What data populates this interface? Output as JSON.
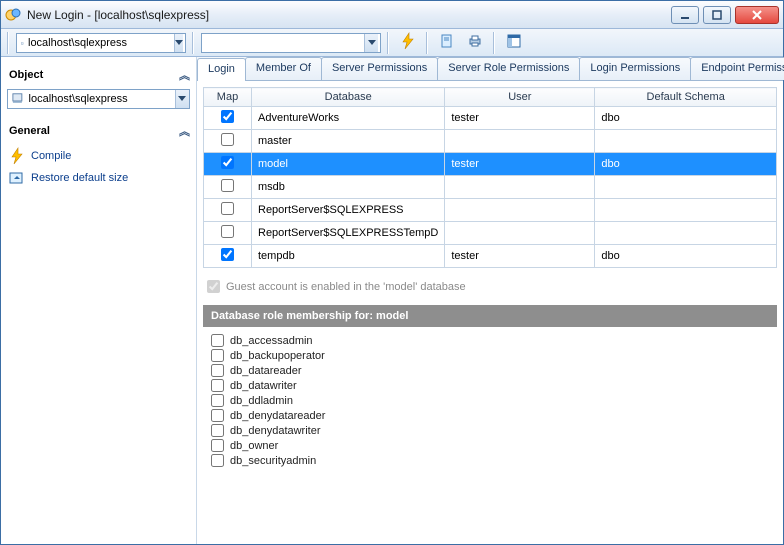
{
  "window": {
    "title": "New Login - [localhost\\sqlexpress]"
  },
  "toolbar": {
    "server_value": "localhost\\sqlexpress",
    "combo2_value": ""
  },
  "left": {
    "object_header": "Object",
    "server_value": "localhost\\sqlexpress",
    "general_header": "General",
    "compile_label": "Compile",
    "restore_label": "Restore default size"
  },
  "tabs": {
    "items": [
      {
        "label": "Login"
      },
      {
        "label": "Member Of"
      },
      {
        "label": "Server Permissions"
      },
      {
        "label": "Server Role Permissions"
      },
      {
        "label": "Login Permissions"
      },
      {
        "label": "Endpoint Permissio"
      }
    ]
  },
  "grid": {
    "cols": {
      "map": "Map",
      "database": "Database",
      "user": "User",
      "schema": "Default Schema"
    },
    "rows": [
      {
        "map": true,
        "db": "AdventureWorks",
        "user": "tester",
        "schema": "dbo",
        "selected": false
      },
      {
        "map": false,
        "db": "master",
        "user": "",
        "schema": "",
        "selected": false
      },
      {
        "map": true,
        "db": "model",
        "user": "tester",
        "schema": "dbo",
        "selected": true
      },
      {
        "map": false,
        "db": "msdb",
        "user": "",
        "schema": "",
        "selected": false
      },
      {
        "map": false,
        "db": "ReportServer$SQLEXPRESS",
        "user": "",
        "schema": "",
        "selected": false
      },
      {
        "map": false,
        "db": "ReportServer$SQLEXPRESSTempD",
        "user": "",
        "schema": "",
        "selected": false
      },
      {
        "map": true,
        "db": "tempdb",
        "user": "tester",
        "schema": "dbo",
        "selected": false
      }
    ]
  },
  "guest": {
    "checked": true,
    "disabled": true,
    "label": "Guest account is enabled in the 'model' database"
  },
  "roles": {
    "header": "Database role membership for: model",
    "items": [
      {
        "label": "db_accessadmin",
        "checked": false
      },
      {
        "label": "db_backupoperator",
        "checked": false
      },
      {
        "label": "db_datareader",
        "checked": false
      },
      {
        "label": "db_datawriter",
        "checked": false
      },
      {
        "label": "db_ddladmin",
        "checked": false
      },
      {
        "label": "db_denydatareader",
        "checked": false
      },
      {
        "label": "db_denydatawriter",
        "checked": false
      },
      {
        "label": "db_owner",
        "checked": false
      },
      {
        "label": "db_securityadmin",
        "checked": false
      }
    ]
  }
}
